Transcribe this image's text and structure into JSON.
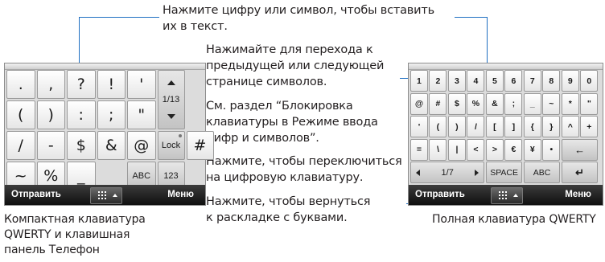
{
  "callouts": {
    "insert_digit": "Нажмите цифру или символ, чтобы вставить\nих в текст.",
    "page_nav": "Нажимайте для перехода к\nпредыдущей или следующей\nстранице символов.",
    "lock_section": "См. раздел “Блокировка\nклавиатуры в Режиме ввода\nцифр и символов”.",
    "switch_numeric": "Нажмите, чтобы переключиться\nна цифровую клавиатуру.",
    "return_letters": "Нажмите, чтобы вернуться\nк раскладке с буквами."
  },
  "captions": {
    "left": "Компактная клавиатура\nQWERTY и клавишная\nпанель Телефон",
    "right": "Полная клавиатура QWERTY"
  },
  "left_keyboard": {
    "rows": [
      [
        ".",
        ",",
        "?",
        "!",
        "'"
      ],
      [
        "(",
        ")",
        ":",
        ";",
        "\""
      ],
      [
        "/",
        "-",
        "$",
        "&",
        "@"
      ],
      [
        "#",
        "~",
        "%",
        "_"
      ]
    ],
    "page_indicator": "1/13",
    "lock_label": "Lock",
    "abc_label": "ABC",
    "num_label": "123",
    "softkey_left": "Отправить",
    "softkey_right": "Меню"
  },
  "right_keyboard": {
    "rows": [
      [
        "1",
        "2",
        "3",
        "4",
        "5",
        "6",
        "7",
        "8",
        "9",
        "0"
      ],
      [
        "@",
        "#",
        "$",
        "%",
        "&",
        ";",
        "_",
        "~",
        "*",
        "\""
      ],
      [
        "'",
        "(",
        ")",
        "/",
        "[",
        "]",
        "{",
        "}",
        "^",
        "+"
      ],
      [
        "=",
        "\\",
        "|",
        "<",
        ">",
        "€",
        "¥",
        "•"
      ]
    ],
    "backspace_glyph": "←",
    "page_indicator": "1/7",
    "space_label": "SPACE",
    "abc_label": "ABC",
    "enter_glyph": "↵",
    "softkey_left": "Отправить",
    "softkey_right": "Меню"
  },
  "colors": {
    "leader_line": "#1f6fc2",
    "text": "#231f20"
  }
}
